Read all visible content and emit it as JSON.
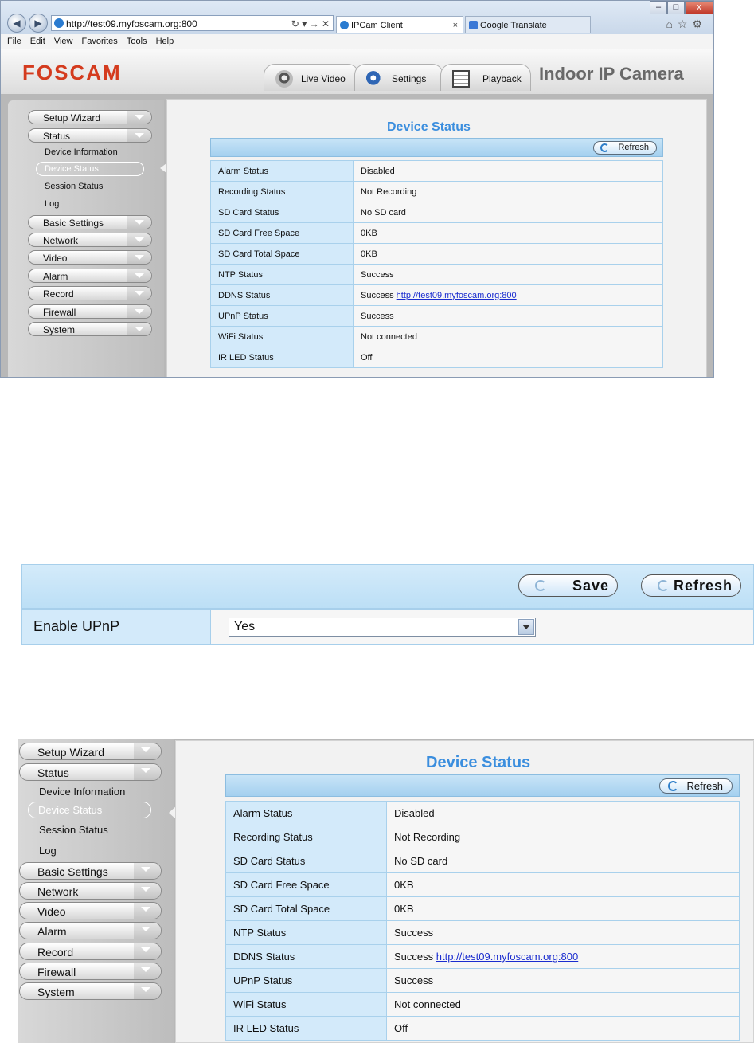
{
  "browser": {
    "address": "http://test09.myfoscam.org:800",
    "tabs": [
      {
        "label": "IPCam Client",
        "close": "×"
      },
      {
        "label": "Google Translate"
      }
    ],
    "menu": [
      "File",
      "Edit",
      "View",
      "Favorites",
      "Tools",
      "Help"
    ],
    "window_controls": [
      "–",
      "□",
      "x"
    ]
  },
  "app": {
    "logo": "FOSCAM",
    "product": "Indoor IP Camera",
    "nav": {
      "live_video": "Live Video",
      "settings": "Settings",
      "playback": "Playback"
    }
  },
  "sidebar": {
    "items": {
      "setup_wizard": "Setup Wizard",
      "status": "Status",
      "device_information": "Device Information",
      "device_status": "Device Status",
      "session_status": "Session Status",
      "log": "Log",
      "basic_settings": "Basic Settings",
      "network": "Network",
      "video": "Video",
      "alarm": "Alarm",
      "record": "Record",
      "firewall": "Firewall",
      "system": "System"
    }
  },
  "device_status": {
    "title": "Device Status",
    "refresh": "Refresh",
    "rows": [
      {
        "label": "Alarm Status",
        "value": "Disabled"
      },
      {
        "label": "Recording Status",
        "value": "Not Recording"
      },
      {
        "label": "SD Card Status",
        "value": "No SD card"
      },
      {
        "label": "SD Card Free Space",
        "value": "0KB"
      },
      {
        "label": "SD Card Total Space",
        "value": "0KB"
      },
      {
        "label": "NTP Status",
        "value": "Success"
      },
      {
        "label": "DDNS Status",
        "value": "Success",
        "link": "http://test09.myfoscam.org:800"
      },
      {
        "label": "UPnP Status",
        "value": "Success"
      },
      {
        "label": "WiFi Status",
        "value": "Not connected"
      },
      {
        "label": "IR LED Status",
        "value": "Off"
      }
    ]
  },
  "upnp": {
    "save": "Save",
    "refresh": "Refresh",
    "label": "Enable UPnP",
    "value": "Yes"
  }
}
